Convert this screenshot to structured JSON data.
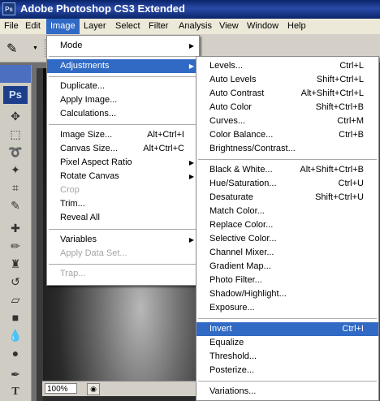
{
  "titlebar": {
    "app_icon": "Ps",
    "title": "Adobe Photoshop CS3 Extended"
  },
  "menubar": [
    "File",
    "Edit",
    "Image",
    "Layer",
    "Select",
    "Filter",
    "Analysis",
    "View",
    "Window",
    "Help"
  ],
  "toolbox": {
    "logo": "Ps"
  },
  "statusbar": {
    "zoom": "100%"
  },
  "image_menu": [
    {
      "label": "Mode",
      "submenu": true
    },
    {
      "label": "Adjustments",
      "submenu": true,
      "highlighted": true
    },
    {
      "label": "Duplicate..."
    },
    {
      "label": "Apply Image..."
    },
    {
      "label": "Calculations..."
    },
    {
      "label": "Image Size...",
      "shortcut": "Alt+Ctrl+I"
    },
    {
      "label": "Canvas Size...",
      "shortcut": "Alt+Ctrl+C"
    },
    {
      "label": "Pixel Aspect Ratio",
      "submenu": true
    },
    {
      "label": "Rotate Canvas",
      "submenu": true
    },
    {
      "label": "Crop",
      "disabled": true
    },
    {
      "label": "Trim..."
    },
    {
      "label": "Reveal All"
    },
    {
      "label": "Variables",
      "submenu": true
    },
    {
      "label": "Apply Data Set...",
      "disabled": true
    },
    {
      "label": "Trap...",
      "disabled": true
    }
  ],
  "adjustments_menu": [
    {
      "label": "Levels...",
      "shortcut": "Ctrl+L"
    },
    {
      "label": "Auto Levels",
      "shortcut": "Shift+Ctrl+L"
    },
    {
      "label": "Auto Contrast",
      "shortcut": "Alt+Shift+Ctrl+L"
    },
    {
      "label": "Auto Color",
      "shortcut": "Shift+Ctrl+B"
    },
    {
      "label": "Curves...",
      "shortcut": "Ctrl+M"
    },
    {
      "label": "Color Balance...",
      "shortcut": "Ctrl+B"
    },
    {
      "label": "Brightness/Contrast..."
    },
    {
      "label": "Black & White...",
      "shortcut": "Alt+Shift+Ctrl+B"
    },
    {
      "label": "Hue/Saturation...",
      "shortcut": "Ctrl+U"
    },
    {
      "label": "Desaturate",
      "shortcut": "Shift+Ctrl+U"
    },
    {
      "label": "Match Color..."
    },
    {
      "label": "Replace Color..."
    },
    {
      "label": "Selective Color..."
    },
    {
      "label": "Channel Mixer..."
    },
    {
      "label": "Gradient Map..."
    },
    {
      "label": "Photo Filter..."
    },
    {
      "label": "Shadow/Highlight..."
    },
    {
      "label": "Exposure..."
    },
    {
      "label": "Invert",
      "shortcut": "Ctrl+I",
      "highlighted": true
    },
    {
      "label": "Equalize"
    },
    {
      "label": "Threshold..."
    },
    {
      "label": "Posterize..."
    },
    {
      "label": "Variations..."
    }
  ],
  "colors": {
    "highlight": "#316ac5",
    "menu_bg": "#ffffff",
    "menubar_bg": "#ece9d8",
    "titlebar": "#0a246a"
  }
}
